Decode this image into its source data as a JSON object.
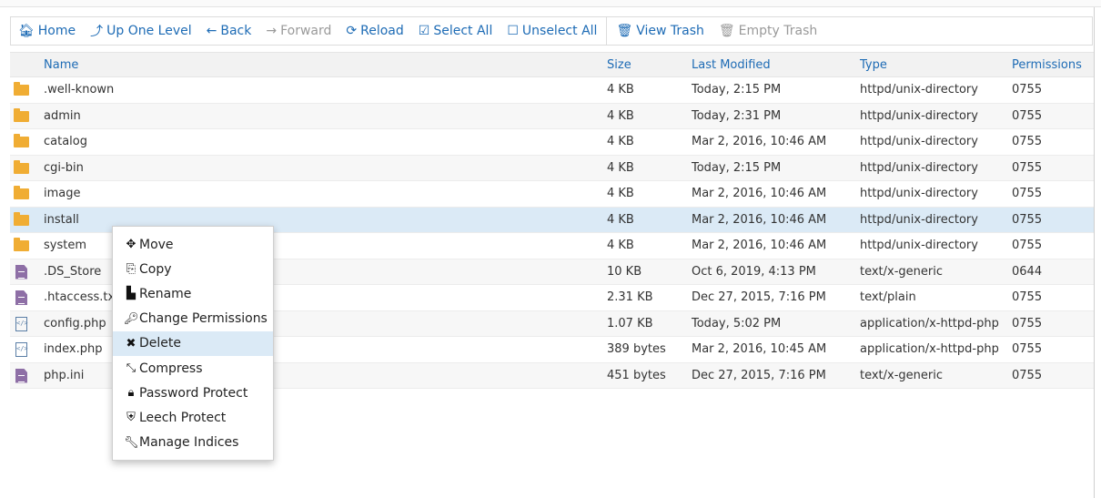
{
  "toolbar": {
    "items": [
      {
        "label": "Home",
        "icon": "home-icon"
      },
      {
        "label": "Up One Level",
        "icon": "level-up-icon"
      },
      {
        "label": "Back",
        "icon": "arrow-left-icon"
      },
      {
        "label": "Forward",
        "icon": "arrow-right-icon"
      },
      {
        "label": "Reload",
        "icon": "refresh-icon"
      },
      {
        "label": "Select All",
        "icon": "checkbox-checked-icon"
      },
      {
        "label": "Unselect All",
        "icon": "checkbox-empty-icon"
      },
      {
        "label": "View Trash",
        "icon": "trash-icon"
      },
      {
        "label": "Empty Trash",
        "icon": "trash-icon"
      }
    ]
  },
  "grid": {
    "columns": {
      "name": "Name",
      "size": "Size",
      "modified": "Last Modified",
      "type": "Type",
      "permissions": "Permissions"
    },
    "rows": [
      {
        "name": ".well-known",
        "size": "4 KB",
        "modified": "Today, 2:15 PM",
        "type": "httpd/unix-directory",
        "perm": "0755",
        "icon": "folder-icon"
      },
      {
        "name": "admin",
        "size": "4 KB",
        "modified": "Today, 2:31 PM",
        "type": "httpd/unix-directory",
        "perm": "0755",
        "icon": "folder-icon"
      },
      {
        "name": "catalog",
        "size": "4 KB",
        "modified": "Mar 2, 2016, 10:46 AM",
        "type": "httpd/unix-directory",
        "perm": "0755",
        "icon": "folder-icon"
      },
      {
        "name": "cgi-bin",
        "size": "4 KB",
        "modified": "Today, 2:15 PM",
        "type": "httpd/unix-directory",
        "perm": "0755",
        "icon": "folder-icon"
      },
      {
        "name": "image",
        "size": "4 KB",
        "modified": "Mar 2, 2016, 10:46 AM",
        "type": "httpd/unix-directory",
        "perm": "0755",
        "icon": "folder-icon"
      },
      {
        "name": "install",
        "size": "4 KB",
        "modified": "Mar 2, 2016, 10:46 AM",
        "type": "httpd/unix-directory",
        "perm": "0755",
        "icon": "folder-icon",
        "selected": true
      },
      {
        "name": "system",
        "size": "4 KB",
        "modified": "Mar 2, 2016, 10:46 AM",
        "type": "httpd/unix-directory",
        "perm": "0755",
        "icon": "folder-icon"
      },
      {
        "name": ".DS_Store",
        "size": "10 KB",
        "modified": "Oct 6, 2019, 4:13 PM",
        "type": "text/x-generic",
        "perm": "0644",
        "icon": "text-file-icon"
      },
      {
        "name": ".htaccess.txt",
        "size": "2.31 KB",
        "modified": "Dec 27, 2015, 7:16 PM",
        "type": "text/plain",
        "perm": "0755",
        "icon": "text-file-icon"
      },
      {
        "name": "config.php",
        "size": "1.07 KB",
        "modified": "Today, 5:02 PM",
        "type": "application/x-httpd-php",
        "perm": "0755",
        "icon": "code-file-icon"
      },
      {
        "name": "index.php",
        "size": "389 bytes",
        "modified": "Mar 2, 2016, 10:45 AM",
        "type": "application/x-httpd-php",
        "perm": "0755",
        "icon": "code-file-icon"
      },
      {
        "name": "php.ini",
        "size": "451 bytes",
        "modified": "Dec 27, 2015, 7:16 PM",
        "type": "text/x-generic",
        "perm": "0755",
        "icon": "text-file-icon"
      }
    ]
  },
  "context_menu": {
    "items": [
      {
        "label": "Move",
        "icon": "move-icon"
      },
      {
        "label": "Copy",
        "icon": "copy-icon"
      },
      {
        "label": "Rename",
        "icon": "file-icon"
      },
      {
        "label": "Change Permissions",
        "icon": "key-icon"
      },
      {
        "label": "Delete",
        "icon": "close-icon",
        "highlighted": true
      },
      {
        "label": "Compress",
        "icon": "compress-icon"
      },
      {
        "label": "Password Protect",
        "icon": "lock-icon"
      },
      {
        "label": "Leech Protect",
        "icon": "shield-icon"
      },
      {
        "label": "Manage Indices",
        "icon": "wrench-icon"
      }
    ]
  },
  "colors": {
    "link": "#1d6bb5",
    "selected_row": "#dbeaf6",
    "folder": "#f0ad34",
    "file": "#8e6fa6"
  }
}
